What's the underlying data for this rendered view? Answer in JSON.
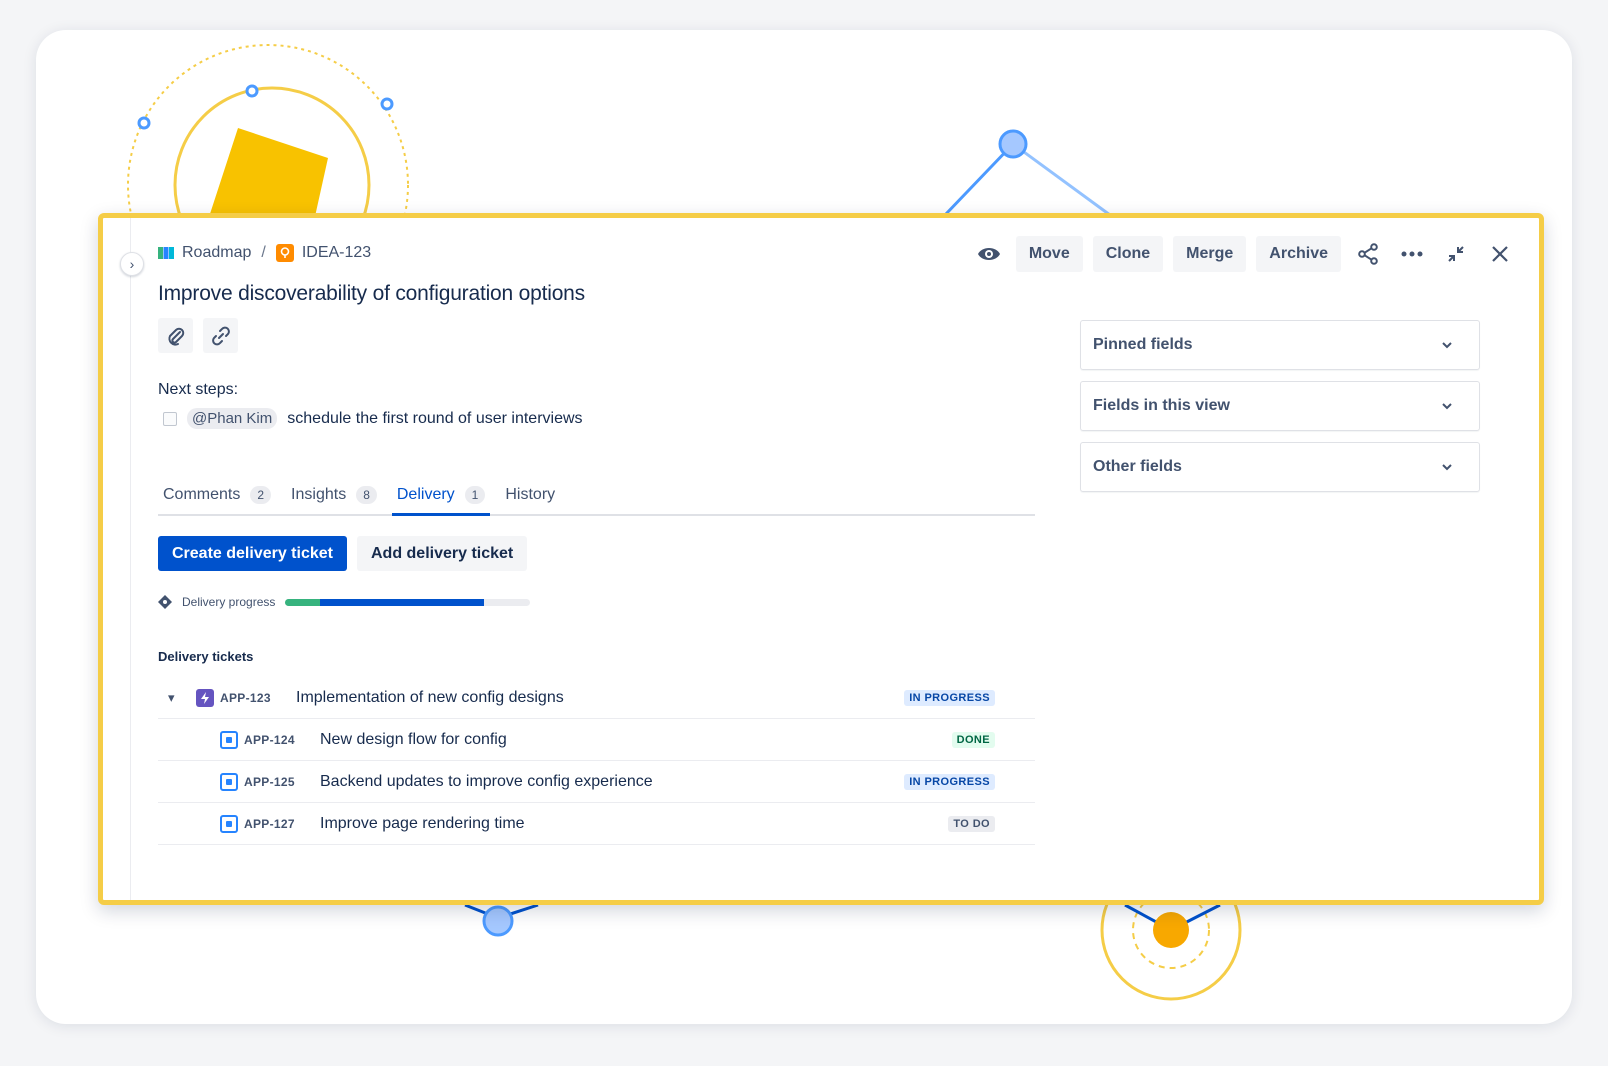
{
  "breadcrumb": {
    "project": "Roadmap",
    "separator": "/",
    "issue_key": "IDEA-123"
  },
  "toolbar": {
    "watch_icon": "eye-icon",
    "move_label": "Move",
    "clone_label": "Clone",
    "merge_label": "Merge",
    "archive_label": "Archive",
    "share_icon": "share-icon",
    "more_icon": "more-icon",
    "collapse_icon": "collapse-icon",
    "close_icon": "close-icon"
  },
  "issue": {
    "title": "Improve discoverability of configuration options",
    "next_steps_label": "Next steps:",
    "todo_mention": "@Phan Kim",
    "todo_text": "schedule the first round of user interviews"
  },
  "tabs": [
    {
      "label": "Comments",
      "count": "2"
    },
    {
      "label": "Insights",
      "count": "8"
    },
    {
      "label": "Delivery",
      "count": "1",
      "active": true
    },
    {
      "label": "History"
    }
  ],
  "delivery": {
    "create_label": "Create delivery ticket",
    "add_label": "Add delivery ticket",
    "progress_label": "Delivery progress",
    "progress": {
      "done_fraction": 0.14,
      "in_progress_fraction": 0.67
    },
    "tickets_label": "Delivery tickets",
    "tickets": [
      {
        "key": "APP-123",
        "summary": "Implementation of new config designs",
        "status": "IN PROGRESS",
        "type": "epic"
      },
      {
        "key": "APP-124",
        "summary": "New design flow for config",
        "status": "DONE",
        "type": "task"
      },
      {
        "key": "APP-125",
        "summary": "Backend updates to improve config experience",
        "status": "IN PROGRESS",
        "type": "task"
      },
      {
        "key": "APP-127",
        "summary": "Improve page rendering time",
        "status": "TO DO",
        "type": "task"
      }
    ]
  },
  "fields": [
    {
      "label": "Pinned fields"
    },
    {
      "label": "Fields in this view"
    },
    {
      "label": "Other fields"
    }
  ],
  "colors": {
    "accent": "#0052cc",
    "highlight": "#f5cd47",
    "done": "#36b37e"
  }
}
